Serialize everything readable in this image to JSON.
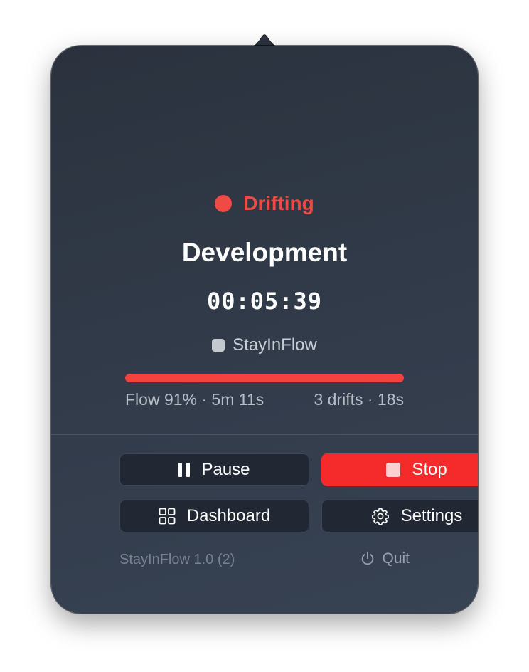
{
  "status": {
    "label": "Drifting",
    "color": "#ef4a44"
  },
  "session": {
    "title": "Development",
    "timer": "00:05:39",
    "app_name": "StayInFlow",
    "app_icon": "app-square-icon"
  },
  "progress": {
    "fill_fraction": 1.0,
    "color": "#f2433f"
  },
  "stats": {
    "flow": "Flow 91% · 5m 11s",
    "drifts": "3 drifts · 18s"
  },
  "buttons": {
    "pause_label": "Pause",
    "pause_icon": "pause-icon",
    "stop_label": "Stop",
    "stop_icon": "stop-icon",
    "stop_color": "#f52a2a",
    "dashboard_label": "Dashboard",
    "dashboard_icon": "grid-icon",
    "settings_label": "Settings",
    "settings_icon": "gear-icon"
  },
  "footer": {
    "version": "StayInFlow 1.0 (2)",
    "quit_label": "Quit",
    "quit_icon": "power-icon"
  }
}
